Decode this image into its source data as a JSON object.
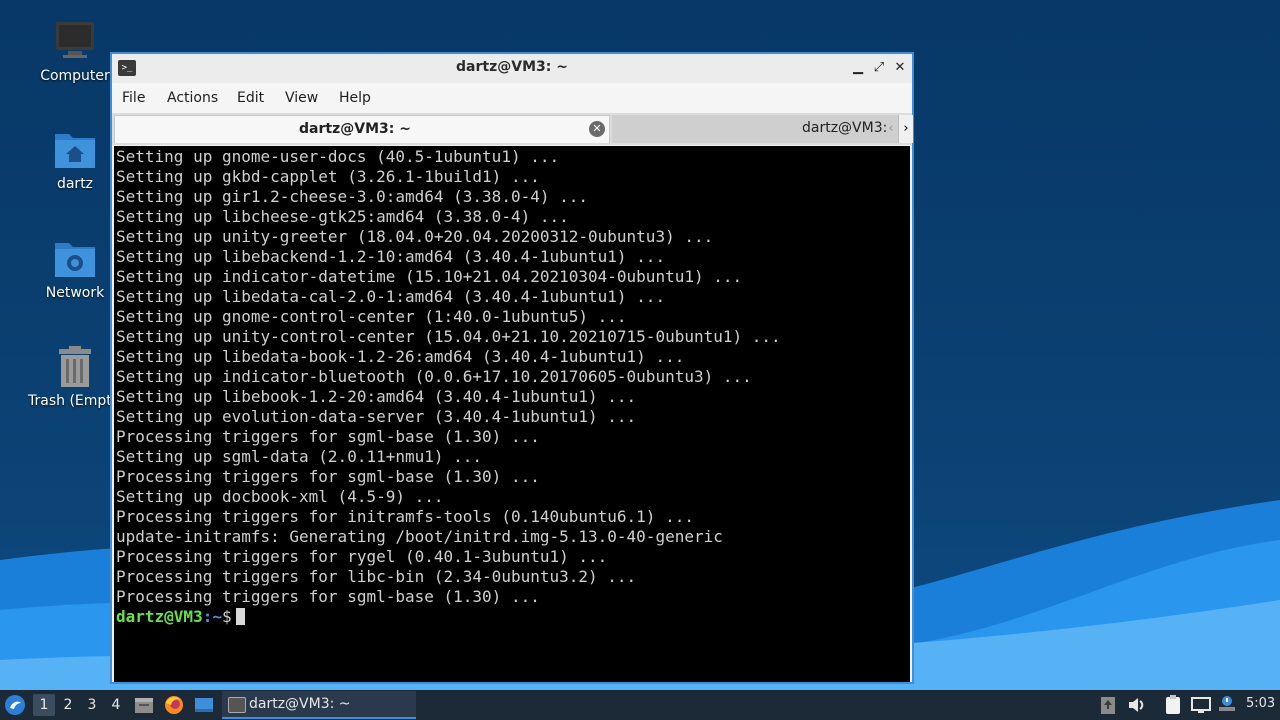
{
  "desktop": {
    "icons": [
      {
        "label": "Computer",
        "icon": "computer-icon"
      },
      {
        "label": "dartz",
        "icon": "home-folder-icon"
      },
      {
        "label": "Network",
        "icon": "network-folder-icon"
      },
      {
        "label": "Trash (Empt",
        "icon": "trash-icon"
      }
    ]
  },
  "window": {
    "title": "dartz@VM3: ~",
    "controls": {
      "minimize": "▁",
      "maximize": "⤢",
      "close": "✕"
    },
    "menu": [
      "File",
      "Actions",
      "Edit",
      "View",
      "Help"
    ],
    "tabs": [
      {
        "label": "dartz@VM3: ~",
        "active": true
      },
      {
        "label": "dartz@VM3:",
        "active": false
      }
    ],
    "tab_close": "✕",
    "tab_nav": {
      "left": "‹",
      "right": "›"
    }
  },
  "terminal": {
    "lines": [
      "Setting up gnome-user-docs (40.5-1ubuntu1) ...",
      "Setting up gkbd-capplet (3.26.1-1build1) ...",
      "Setting up gir1.2-cheese-3.0:amd64 (3.38.0-4) ...",
      "Setting up libcheese-gtk25:amd64 (3.38.0-4) ...",
      "Setting up unity-greeter (18.04.0+20.04.20200312-0ubuntu3) ...",
      "Setting up libebackend-1.2-10:amd64 (3.40.4-1ubuntu1) ...",
      "Setting up indicator-datetime (15.10+21.04.20210304-0ubuntu1) ...",
      "Setting up libedata-cal-2.0-1:amd64 (3.40.4-1ubuntu1) ...",
      "Setting up gnome-control-center (1:40.0-1ubuntu5) ...",
      "Setting up unity-control-center (15.04.0+21.10.20210715-0ubuntu1) ...",
      "Setting up libedata-book-1.2-26:amd64 (3.40.4-1ubuntu1) ...",
      "Setting up indicator-bluetooth (0.0.6+17.10.20170605-0ubuntu3) ...",
      "Setting up libebook-1.2-20:amd64 (3.40.4-1ubuntu1) ...",
      "Setting up evolution-data-server (3.40.4-1ubuntu1) ...",
      "Processing triggers for sgml-base (1.30) ...",
      "Setting up sgml-data (2.0.11+nmu1) ...",
      "Processing triggers for sgml-base (1.30) ...",
      "Setting up docbook-xml (4.5-9) ...",
      "Processing triggers for initramfs-tools (0.140ubuntu6.1) ...",
      "update-initramfs: Generating /boot/initrd.img-5.13.0-40-generic",
      "Processing triggers for rygel (0.40.1-3ubuntu1) ...",
      "Processing triggers for libc-bin (2.34-0ubuntu3.2) ...",
      "Processing triggers for sgml-base (1.30) ..."
    ],
    "prompt": {
      "user": "dartz@VM3",
      "sep": ":",
      "path": "~",
      "symbol": "$"
    }
  },
  "taskbar": {
    "workspaces": [
      "1",
      "2",
      "3",
      "4"
    ],
    "active_workspace": "1",
    "task_label": "dartz@VM3: ~",
    "clock": "5:03"
  },
  "colors": {
    "accent": "#3c8fd8",
    "prompt_user": "#67e04a",
    "prompt_path": "#4f8fe6",
    "terminal_bg": "#000000"
  }
}
